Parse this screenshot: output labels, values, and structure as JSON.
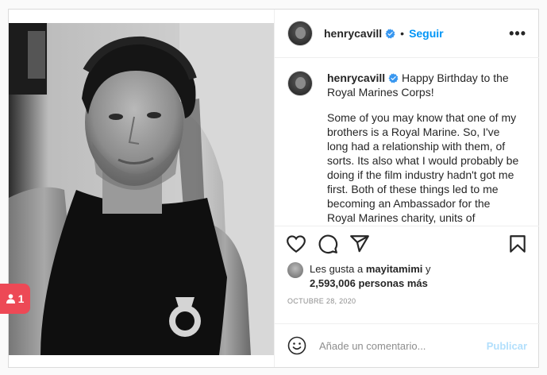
{
  "post": {
    "username": "henrycavill",
    "follow_label": "Seguir",
    "dot": "•",
    "more_label": "•••",
    "caption_line1": "Happy Birthday to the Royal Marines Corps!",
    "caption_body": "Some of you may know that one of my brothers is a Royal Marine. So, I've long had a relationship with them, of sorts. Its also what I would probably be doing if the film industry hadn't got me first. Both of these things led to me becoming an Ambassador for the Royal Marines charity, units of"
  },
  "likes": {
    "prefix": "Les gusta a",
    "user": "mayitamimi",
    "joiner": "y",
    "count_text": "2,593,006 personas más"
  },
  "date": "OCTUBRE 28, 2020",
  "comment": {
    "placeholder": "Añade un comentario...",
    "publish_label": "Publicar"
  },
  "notification": {
    "count": "1"
  },
  "colors": {
    "accent": "#0095f6",
    "verified": "#3897f0",
    "notification": "#ed4956",
    "publish_disabled": "#b2dffc"
  },
  "icons": [
    "verified-badge-icon",
    "more-icon",
    "heart-icon",
    "comment-icon",
    "share-icon",
    "bookmark-icon",
    "emoji-icon",
    "user-icon"
  ]
}
